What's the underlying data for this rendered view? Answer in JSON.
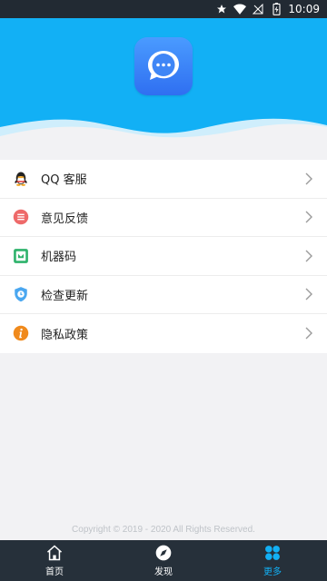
{
  "status_bar": {
    "time": "10:09",
    "icons": [
      "star-icon",
      "wifi-icon",
      "signal-off-icon",
      "battery-charging-icon"
    ]
  },
  "header": {
    "logo_icon": "chat-bubble-icon",
    "background_color": "#12b0f5"
  },
  "menu": {
    "items": [
      {
        "label": "QQ 客服",
        "icon": "qq-penguin-icon",
        "color": "#f4a623"
      },
      {
        "label": "意见反馈",
        "icon": "feedback-list-icon",
        "color": "#ee6a6a"
      },
      {
        "label": "机器码",
        "icon": "machine-code-icon",
        "color": "#2fb36c"
      },
      {
        "label": "检查更新",
        "icon": "shield-update-icon",
        "color": "#4aa7f0"
      },
      {
        "label": "隐私政策",
        "icon": "info-icon",
        "color": "#f08a1c"
      }
    ]
  },
  "footer": {
    "copyright": "Copyright © 2019 - 2020 All Rights Reserved."
  },
  "tabbar": {
    "tabs": [
      {
        "label": "首页",
        "icon": "home-icon",
        "active": false
      },
      {
        "label": "发现",
        "icon": "compass-icon",
        "active": false
      },
      {
        "label": "更多",
        "icon": "more-grid-icon",
        "active": true
      }
    ],
    "active_color": "#12b0f5"
  }
}
